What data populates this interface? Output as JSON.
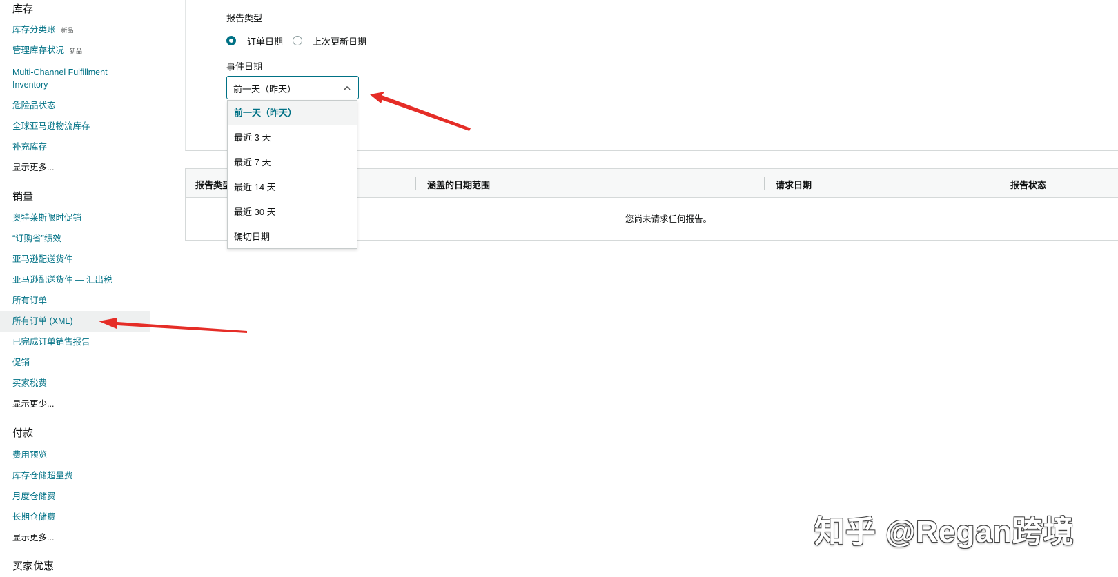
{
  "sidebar": {
    "inventory": {
      "title": "库存",
      "items": [
        {
          "label": "库存分类账",
          "badge": "新品"
        },
        {
          "label": "管理库存状况",
          "badge": "新品"
        },
        {
          "label": "Multi-Channel Fulfillment Inventory"
        },
        {
          "label": "危险品状态"
        },
        {
          "label": "全球亚马逊物流库存"
        },
        {
          "label": "补充库存"
        }
      ],
      "show_more": "显示更多..."
    },
    "sales": {
      "title": "销量",
      "items": [
        {
          "label": "奥特莱斯限时促销"
        },
        {
          "label": "“订购省”绩效"
        },
        {
          "label": "亚马逊配送货件"
        },
        {
          "label": "亚马逊配送货件 — 汇出税"
        },
        {
          "label": "所有订单"
        },
        {
          "label": "所有订单 (XML)",
          "active": true
        },
        {
          "label": "已完成订单销售报告"
        },
        {
          "label": "促销"
        },
        {
          "label": "买家税费"
        }
      ],
      "show_less": "显示更少..."
    },
    "payments": {
      "title": "付款",
      "items": [
        {
          "label": "费用预览"
        },
        {
          "label": "库存仓储超量费"
        },
        {
          "label": "月度仓储费"
        },
        {
          "label": "长期仓储费"
        }
      ],
      "show_more": "显示更多..."
    },
    "buyer_discounts": {
      "title": "买家优惠"
    }
  },
  "form": {
    "report_type_label": "报告类型",
    "radio_options": [
      {
        "label": "订单日期",
        "checked": true
      },
      {
        "label": "上次更新日期",
        "checked": false
      }
    ],
    "event_date_label": "事件日期",
    "select": {
      "value": "前一天（昨天）",
      "expanded": true,
      "options": [
        "前一天（昨天）",
        "最近 3 天",
        "最近 7 天",
        "最近 14 天",
        "最近 30 天",
        "确切日期"
      ],
      "selected_index": 0
    }
  },
  "table": {
    "headers": [
      "报告类型",
      "涵盖的日期范围",
      "请求日期",
      "报告状态"
    ],
    "empty_message": "您尚未请求任何报告。"
  },
  "watermark": "知乎 @Regan跨境",
  "colors": {
    "link": "#007185",
    "annotation_arrow": "#e52d27"
  }
}
